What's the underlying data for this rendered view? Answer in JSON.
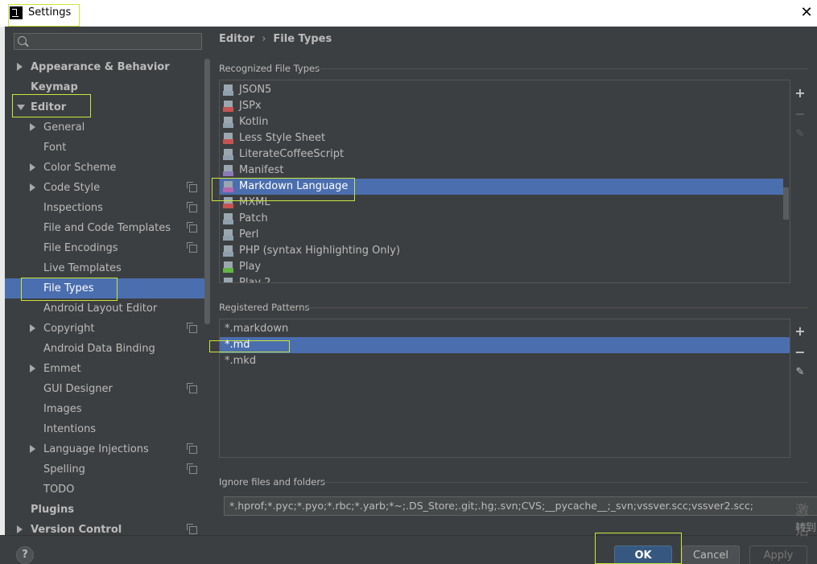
{
  "window": {
    "title": "Settings"
  },
  "sidebar": {
    "search_placeholder": "",
    "items": [
      {
        "label": "Appearance & Behavior",
        "bold": true,
        "arrow": "right",
        "indent": 0,
        "proj": false
      },
      {
        "label": "Keymap",
        "bold": true,
        "arrow": "none",
        "indent": 0,
        "proj": false
      },
      {
        "label": "Editor",
        "bold": true,
        "arrow": "down",
        "indent": 0,
        "proj": false
      },
      {
        "label": "General",
        "bold": false,
        "arrow": "right",
        "indent": 1,
        "proj": false
      },
      {
        "label": "Font",
        "bold": false,
        "arrow": "none",
        "indent": 1,
        "proj": false
      },
      {
        "label": "Color Scheme",
        "bold": false,
        "arrow": "right",
        "indent": 1,
        "proj": false
      },
      {
        "label": "Code Style",
        "bold": false,
        "arrow": "right",
        "indent": 1,
        "proj": true
      },
      {
        "label": "Inspections",
        "bold": false,
        "arrow": "none",
        "indent": 1,
        "proj": true
      },
      {
        "label": "File and Code Templates",
        "bold": false,
        "arrow": "none",
        "indent": 1,
        "proj": true
      },
      {
        "label": "File Encodings",
        "bold": false,
        "arrow": "none",
        "indent": 1,
        "proj": true
      },
      {
        "label": "Live Templates",
        "bold": false,
        "arrow": "none",
        "indent": 1,
        "proj": false
      },
      {
        "label": "File Types",
        "bold": false,
        "arrow": "none",
        "indent": 1,
        "proj": false,
        "selected": true
      },
      {
        "label": "Android Layout Editor",
        "bold": false,
        "arrow": "none",
        "indent": 1,
        "proj": false
      },
      {
        "label": "Copyright",
        "bold": false,
        "arrow": "right",
        "indent": 1,
        "proj": true
      },
      {
        "label": "Android Data Binding",
        "bold": false,
        "arrow": "none",
        "indent": 1,
        "proj": false
      },
      {
        "label": "Emmet",
        "bold": false,
        "arrow": "right",
        "indent": 1,
        "proj": false
      },
      {
        "label": "GUI Designer",
        "bold": false,
        "arrow": "none",
        "indent": 1,
        "proj": true
      },
      {
        "label": "Images",
        "bold": false,
        "arrow": "none",
        "indent": 1,
        "proj": false
      },
      {
        "label": "Intentions",
        "bold": false,
        "arrow": "none",
        "indent": 1,
        "proj": false
      },
      {
        "label": "Language Injections",
        "bold": false,
        "arrow": "right",
        "indent": 1,
        "proj": true
      },
      {
        "label": "Spelling",
        "bold": false,
        "arrow": "none",
        "indent": 1,
        "proj": true
      },
      {
        "label": "TODO",
        "bold": false,
        "arrow": "none",
        "indent": 1,
        "proj": false
      },
      {
        "label": "Plugins",
        "bold": true,
        "arrow": "none",
        "indent": 0,
        "proj": false
      },
      {
        "label": "Version Control",
        "bold": true,
        "arrow": "right",
        "indent": 0,
        "proj": true
      }
    ]
  },
  "breadcrumb": {
    "parent": "Editor",
    "separator": "›",
    "current": "File Types"
  },
  "recognized": {
    "title": "Recognized File Types",
    "items": [
      {
        "label": "JSON5",
        "icon": "json5-file-icon",
        "badge": "#8fa0ad"
      },
      {
        "label": "JSPx",
        "icon": "jspx-file-icon",
        "badge": "#c75450"
      },
      {
        "label": "Kotlin",
        "icon": "kotlin-file-icon",
        "badge": "#8fa0ad"
      },
      {
        "label": "Less Style Sheet",
        "icon": "less-file-icon",
        "badge": "#c75450"
      },
      {
        "label": "LiterateCoffeeScript",
        "icon": "coffeescript-file-icon",
        "badge": "#8fa0ad"
      },
      {
        "label": "Manifest",
        "icon": "manifest-file-icon",
        "badge": "#8b7ab8"
      },
      {
        "label": "Markdown Language",
        "icon": "markdown-file-icon",
        "badge": "#b567b0",
        "selected": true
      },
      {
        "label": "MXML",
        "icon": "mxml-file-icon",
        "badge": "#c75450"
      },
      {
        "label": "Patch",
        "icon": "patch-file-icon",
        "badge": "#8fa0ad"
      },
      {
        "label": "Perl",
        "icon": "perl-file-icon",
        "badge": "#8fa0ad"
      },
      {
        "label": "PHP (syntax Highlighting Only)",
        "icon": "php-file-icon",
        "badge": "#8fa0ad"
      },
      {
        "label": "Play",
        "icon": "play-file-icon",
        "badge": "#62b543"
      },
      {
        "label": "Play 2",
        "icon": "play2-file-icon",
        "badge": "#8fa0ad"
      }
    ]
  },
  "patterns": {
    "title": "Registered Patterns",
    "items": [
      {
        "label": "*.markdown"
      },
      {
        "label": "*.md",
        "selected": true
      },
      {
        "label": "*.mkd"
      }
    ]
  },
  "toolbar": {
    "add": "+",
    "remove": "−",
    "edit": "✎"
  },
  "ignore": {
    "title": "Ignore files and folders",
    "value": "*.hprof;*.pyc;*.pyo;*.rbc;*.yarb;*~;.DS_Store;.git;.hg;.svn;CVS;__pycache__;_svn;vssver.scc;vssver2.scc;"
  },
  "buttons": {
    "help": "?",
    "ok": "OK",
    "cancel": "Cancel",
    "apply": "Apply"
  },
  "watermark": {
    "line1": "激活",
    "line2": "转到"
  },
  "colors": {
    "selection": "#4b6eaf",
    "panel": "#3c3f41",
    "highlight": "#c8e63c"
  }
}
